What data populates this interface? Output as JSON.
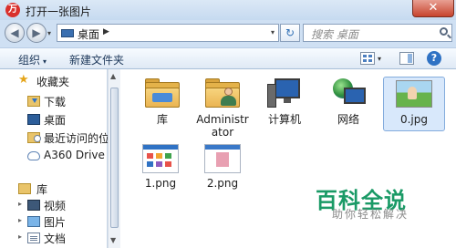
{
  "window": {
    "title": "打开一张图片",
    "app_icon_glyph": "万",
    "close_glyph": "✕"
  },
  "nav": {
    "back_glyph": "◀",
    "forward_glyph": "▶",
    "dropdown_glyph": "▾"
  },
  "address": {
    "location": "桌面",
    "separator": "▶",
    "dropdown_glyph": "▾",
    "refresh_glyph": "↻"
  },
  "search": {
    "placeholder": "搜索 桌面"
  },
  "toolbar": {
    "organize_label": "组织",
    "caret": "▾",
    "new_folder_label": "新建文件夹",
    "help_glyph": "?"
  },
  "navpane": {
    "favorites_label": "收藏夹",
    "items": [
      {
        "label": "下载",
        "icon": "download-folder-icon"
      },
      {
        "label": "桌面",
        "icon": "desktop-icon"
      },
      {
        "label": "最近访问的位置",
        "icon": "recent-places-icon"
      },
      {
        "label": "A360 Drive",
        "icon": "cloud-drive-icon"
      }
    ],
    "libraries_label": "库",
    "library_items": [
      {
        "label": "视频",
        "icon": "videos-icon"
      },
      {
        "label": "图片",
        "icon": "pictures-icon"
      },
      {
        "label": "文档",
        "icon": "documents-icon"
      }
    ],
    "expander_glyph": "▸"
  },
  "files": [
    {
      "label": "库",
      "icon": "library-folder-icon",
      "selected": false
    },
    {
      "label": "Administrator",
      "icon": "user-folder-icon",
      "selected": false
    },
    {
      "label": "计算机",
      "icon": "computer-icon",
      "selected": false
    },
    {
      "label": "网络",
      "icon": "network-icon",
      "selected": false
    },
    {
      "label": "0.jpg",
      "icon": "image-thumbnail-icon",
      "selected": true
    },
    {
      "label": "1.png",
      "icon": "image-thumbnail-icon",
      "selected": false
    },
    {
      "label": "2.png",
      "icon": "image-thumbnail-icon",
      "selected": false
    }
  ],
  "scroll": {
    "up_glyph": "▲",
    "down_glyph": "▼"
  },
  "watermark": {
    "title": "百科全说",
    "subtitle": "助你轻松解决"
  },
  "colors": {
    "accent": "#2f72c4",
    "selection": "#d8e8fb",
    "watermark": "#1a9a66",
    "close": "#c7432d"
  }
}
